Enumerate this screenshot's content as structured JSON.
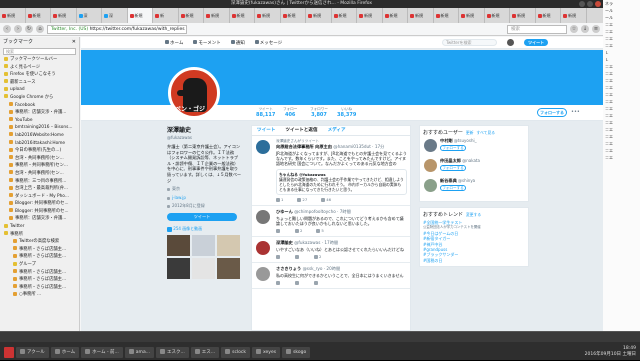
{
  "window": {
    "title": "深澤諭史(fukazawas)さん | Twitterから送信され... - Mozilla Firefox"
  },
  "tabs": [
    {
      "label": "新規"
    },
    {
      "label": "新規"
    },
    {
      "label": "新規"
    },
    {
      "label": "深"
    },
    {
      "label": "深"
    },
    {
      "label": "新規"
    },
    {
      "label": "新"
    },
    {
      "label": "新規"
    },
    {
      "label": "新規"
    },
    {
      "label": "新規"
    },
    {
      "label": "新規"
    },
    {
      "label": "新規"
    },
    {
      "label": "新規"
    },
    {
      "label": "新規"
    },
    {
      "label": "新規"
    },
    {
      "label": "新規"
    },
    {
      "label": "新規"
    },
    {
      "label": "新規"
    },
    {
      "label": "新規"
    },
    {
      "label": "新規"
    },
    {
      "label": "新規"
    },
    {
      "label": "新規"
    },
    {
      "label": "新規"
    }
  ],
  "nav": {
    "url_secure": "Twitter, Inc. (US)",
    "url": "https://twitter.com/fukazawas/with_replies",
    "search_placeholder": "検索"
  },
  "sidebar": {
    "title": "ブックマーク",
    "search_placeholder": "検索",
    "items": [
      {
        "label": "ブックマークツールバー"
      },
      {
        "label": "よく見るページ"
      },
      {
        "label": "Firefox を使いこなそう"
      },
      {
        "label": "最新ニュース"
      },
      {
        "label": "upload"
      },
      {
        "label": "Google Chrome から"
      },
      {
        "label": "Facebook"
      },
      {
        "label": "事務所：店舗交渉・弁護..."
      },
      {
        "label": "YouTube"
      },
      {
        "label": "bmtraining2016 – Bisons..."
      },
      {
        "label": "lab2016Website:Home"
      },
      {
        "label": "lab2016ittakashi:Home"
      },
      {
        "label": "今日の事務所(先生の...)"
      },
      {
        "label": "台湾・共同事務所(セン..."
      },
      {
        "label": "事務所・共同事務所(セン..."
      },
      {
        "label": "台湾・共同事務所(セン..."
      },
      {
        "label": "事務所：三つ目の事務所..."
      },
      {
        "label": "台湾上告・最高裁判所(弁..."
      },
      {
        "label": "ダッシュボード - My Pho..."
      },
      {
        "label": "Blogger: 共同事務所のセ..."
      },
      {
        "label": "Blogger: 共同事務所のセ..."
      },
      {
        "label": "事務所：店舗交渉・弁護..."
      },
      {
        "label": "Twitter"
      },
      {
        "label": "事務所"
      },
      {
        "label": "Twitterの高度な検索"
      },
      {
        "label": "事務所・さらば店舗主..."
      },
      {
        "label": "事務所・さらば店舗主..."
      },
      {
        "label": "グループ"
      },
      {
        "label": "事務所・さらば店舗主..."
      },
      {
        "label": "事務所・さらば店舗主..."
      },
      {
        "label": "事務所・さらば店舗主..."
      },
      {
        "label": "○事務所 ..."
      }
    ]
  },
  "twitter": {
    "nav": {
      "home": "ホーム",
      "moments": "モーメント",
      "notifications": "通知",
      "messages": "メッセージ",
      "search_placeholder": "Twitterを検索",
      "tweet_button": "ツイート"
    },
    "stats": [
      {
        "label": "ツイート",
        "value": "88,117"
      },
      {
        "label": "フォロー",
        "value": "406"
      },
      {
        "label": "フォロワー",
        "value": "3,807"
      },
      {
        "label": "いいね",
        "value": "38,379"
      }
    ],
    "follow_button": "フォローする",
    "more": "•••",
    "avatar_text": "ベン・ゴジ",
    "profile": {
      "name": "深澤諭史",
      "handle": "@fukazawas",
      "bio": "弁護士（第二東京弁護士会）。アイコンはフォロワーの仁々公作。ＩＴ法務（システム開発訴訟等、ネットトラブル・誹謗中傷、ＩＴ企業の一般法務）を中心に、刑事事件や刑事弁護を取り扱っています。詳しくは、↓５月数ページ",
      "location": "東京",
      "website": "j-law.jp",
      "joined": "2012年8月に登録",
      "tweet_to": "ツイート",
      "media_link": "254 画像と動画"
    },
    "timeline_tabs": [
      {
        "label": "ツイート"
      },
      {
        "label": "ツイートと返信"
      },
      {
        "label": "メディア"
      }
    ],
    "tweets": [
      {
        "context": "深澤諭史さんがリツイート",
        "author": "向原総合法律事務所 向原主由",
        "meta": "@hanami0135dut · 17分",
        "body": "JR北海道がよくなってますが、JR北海道でもとの弁護士会を見てくるようなんです。数年くらいです。また、ことをやってみたんですけど。アイヌ語地名研究 国会について。なんだかよくってのある元気な地方会の",
        "quote_author": "ちゃんねる @fukazawas",
        "quote_body": "議運発信の政策価格の、判護士会の手作業でやってきたけど、相違しようとしたらJR北海道のために行われそう。 市内ボーカルから自殺の実体もともある仕事になってきた行きたいと思う。",
        "replies": "1",
        "retweets": "27",
        "likes": "46"
      },
      {
        "context": "",
        "author": "ひゆーん",
        "meta": "@chimpofooltoycho · 7時間",
        "body": "ちょっと難しい問題があるので、これについてどう考えるかも含めて議論しておいたほうが良いかもしれないと思いました。",
        "quote_author": "",
        "quote_body": "",
        "replies": "",
        "retweets": "2",
        "likes": "5"
      },
      {
        "context": "",
        "author": "深澤諭史",
        "meta": "@fukazawas · 17時間",
        "body": "いやすごいなあ（いいね）とあとは公認させてくれたらいいんだけどね",
        "quote_author": "",
        "quote_body": "",
        "replies": "",
        "retweets": "",
        "likes": "2"
      },
      {
        "context": "",
        "author": "ささきりょう",
        "meta": "@ssk_ryo · 20時間",
        "body": "私の高校生に何ができるかということで、全日本にはうまくいきません",
        "quote_author": "",
        "quote_body": "",
        "replies": "",
        "retweets": "",
        "likes": ""
      }
    ],
    "who_to_follow": {
      "title": "おすすめユーザー",
      "refresh": "更新",
      "all": "すべて見る",
      "users": [
        {
          "name": "中村剛",
          "handle": "@tsuyoshi_",
          "follow": "フォローする"
        },
        {
          "name": "仲田晶太郎",
          "handle": "@nakata",
          "follow": "フォローする"
        },
        {
          "name": "新谷泰典",
          "handle": "@shinya",
          "follow": "フォローする"
        }
      ]
    },
    "trends": {
      "title": "おすすめトレンド",
      "change": "変更する",
      "items": [
        {
          "tag": "#全国統一学生テスト",
          "sub": "公益財団法人が学力コンテストを開催"
        },
        {
          "tag": "#今日はゲームの日",
          "sub": ""
        },
        {
          "tag": "#新宿タイガー",
          "sub": ""
        },
        {
          "tag": "#神戸中谷",
          "sub": ""
        },
        {
          "tag": "#grandpuss",
          "sub": ""
        },
        {
          "tag": "#ブラックサンダー",
          "sub": ""
        },
        {
          "tag": "#国税の日",
          "sub": ""
        }
      ]
    }
  },
  "right_strip": {
    "lines": [
      "ネラ",
      "ール",
      "ール",
      "＝エ",
      "＝エ",
      "＝エ",
      "＝エ",
      "Ｌ",
      "Ｌ",
      "＝エ",
      "＝エ",
      "＝エ",
      "＝エ",
      "＝エ",
      "＝エ",
      "＝エ",
      "＝エ",
      "＝エ",
      "＝エ",
      "＝エ",
      "＝エ",
      "＝エ",
      "＝エ"
    ]
  },
  "taskbar": {
    "tasks": [
      {
        "label": "アクール"
      },
      {
        "label": "ホーム"
      },
      {
        "label": "ホーム - 前..."
      },
      {
        "label": "ama..."
      },
      {
        "label": "エスク..."
      },
      {
        "label": "エス..."
      },
      {
        "label": "sclock"
      },
      {
        "label": "xeyes"
      },
      {
        "label": "skogo"
      }
    ],
    "time": "18:49",
    "date": "2016年09月10日 土曜日"
  }
}
